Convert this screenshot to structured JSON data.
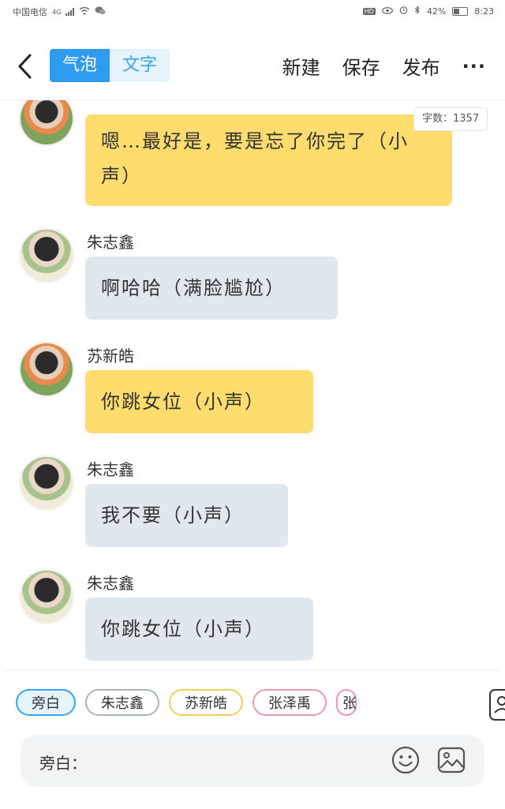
{
  "status_bar": {
    "carrier": "中国电信",
    "network": "4G",
    "hd": "HD",
    "battery": "42%",
    "time": "8:23"
  },
  "top_bar": {
    "segment": {
      "bubble_label": "气泡",
      "text_label": "文字",
      "selected": "bubble"
    },
    "actions": {
      "new": "新建",
      "save": "保存",
      "publish": "发布",
      "more": "···"
    }
  },
  "chat": {
    "word_count": "字数：1357",
    "messages": [
      {
        "speaker": "",
        "text": "嗯…最好是，要是忘了你完了（小声）",
        "style": "yellow"
      },
      {
        "speaker": "朱志鑫",
        "text": "啊哈哈（满脸尴尬）",
        "style": "grey"
      },
      {
        "speaker": "苏新皓",
        "text": "你跳女位（小声）",
        "style": "yellow"
      },
      {
        "speaker": "朱志鑫",
        "text": "我不要（小声）",
        "style": "grey"
      },
      {
        "speaker": "朱志鑫",
        "text": "你跳女位（小声）",
        "style": "grey"
      }
    ]
  },
  "character_chips": [
    "旁白",
    "朱志鑫",
    "苏新皓",
    "张泽禹",
    "张"
  ],
  "input": {
    "prompt": "旁白："
  },
  "colors": {
    "accent": "#2f9bf0",
    "yellow_bubble": "#fedc6e",
    "grey_bubble": "#e1e7ef"
  },
  "icons": {
    "back": "chevron-left-icon",
    "emoji": "smile-icon",
    "image": "image-icon",
    "side": "contact-card-icon"
  }
}
